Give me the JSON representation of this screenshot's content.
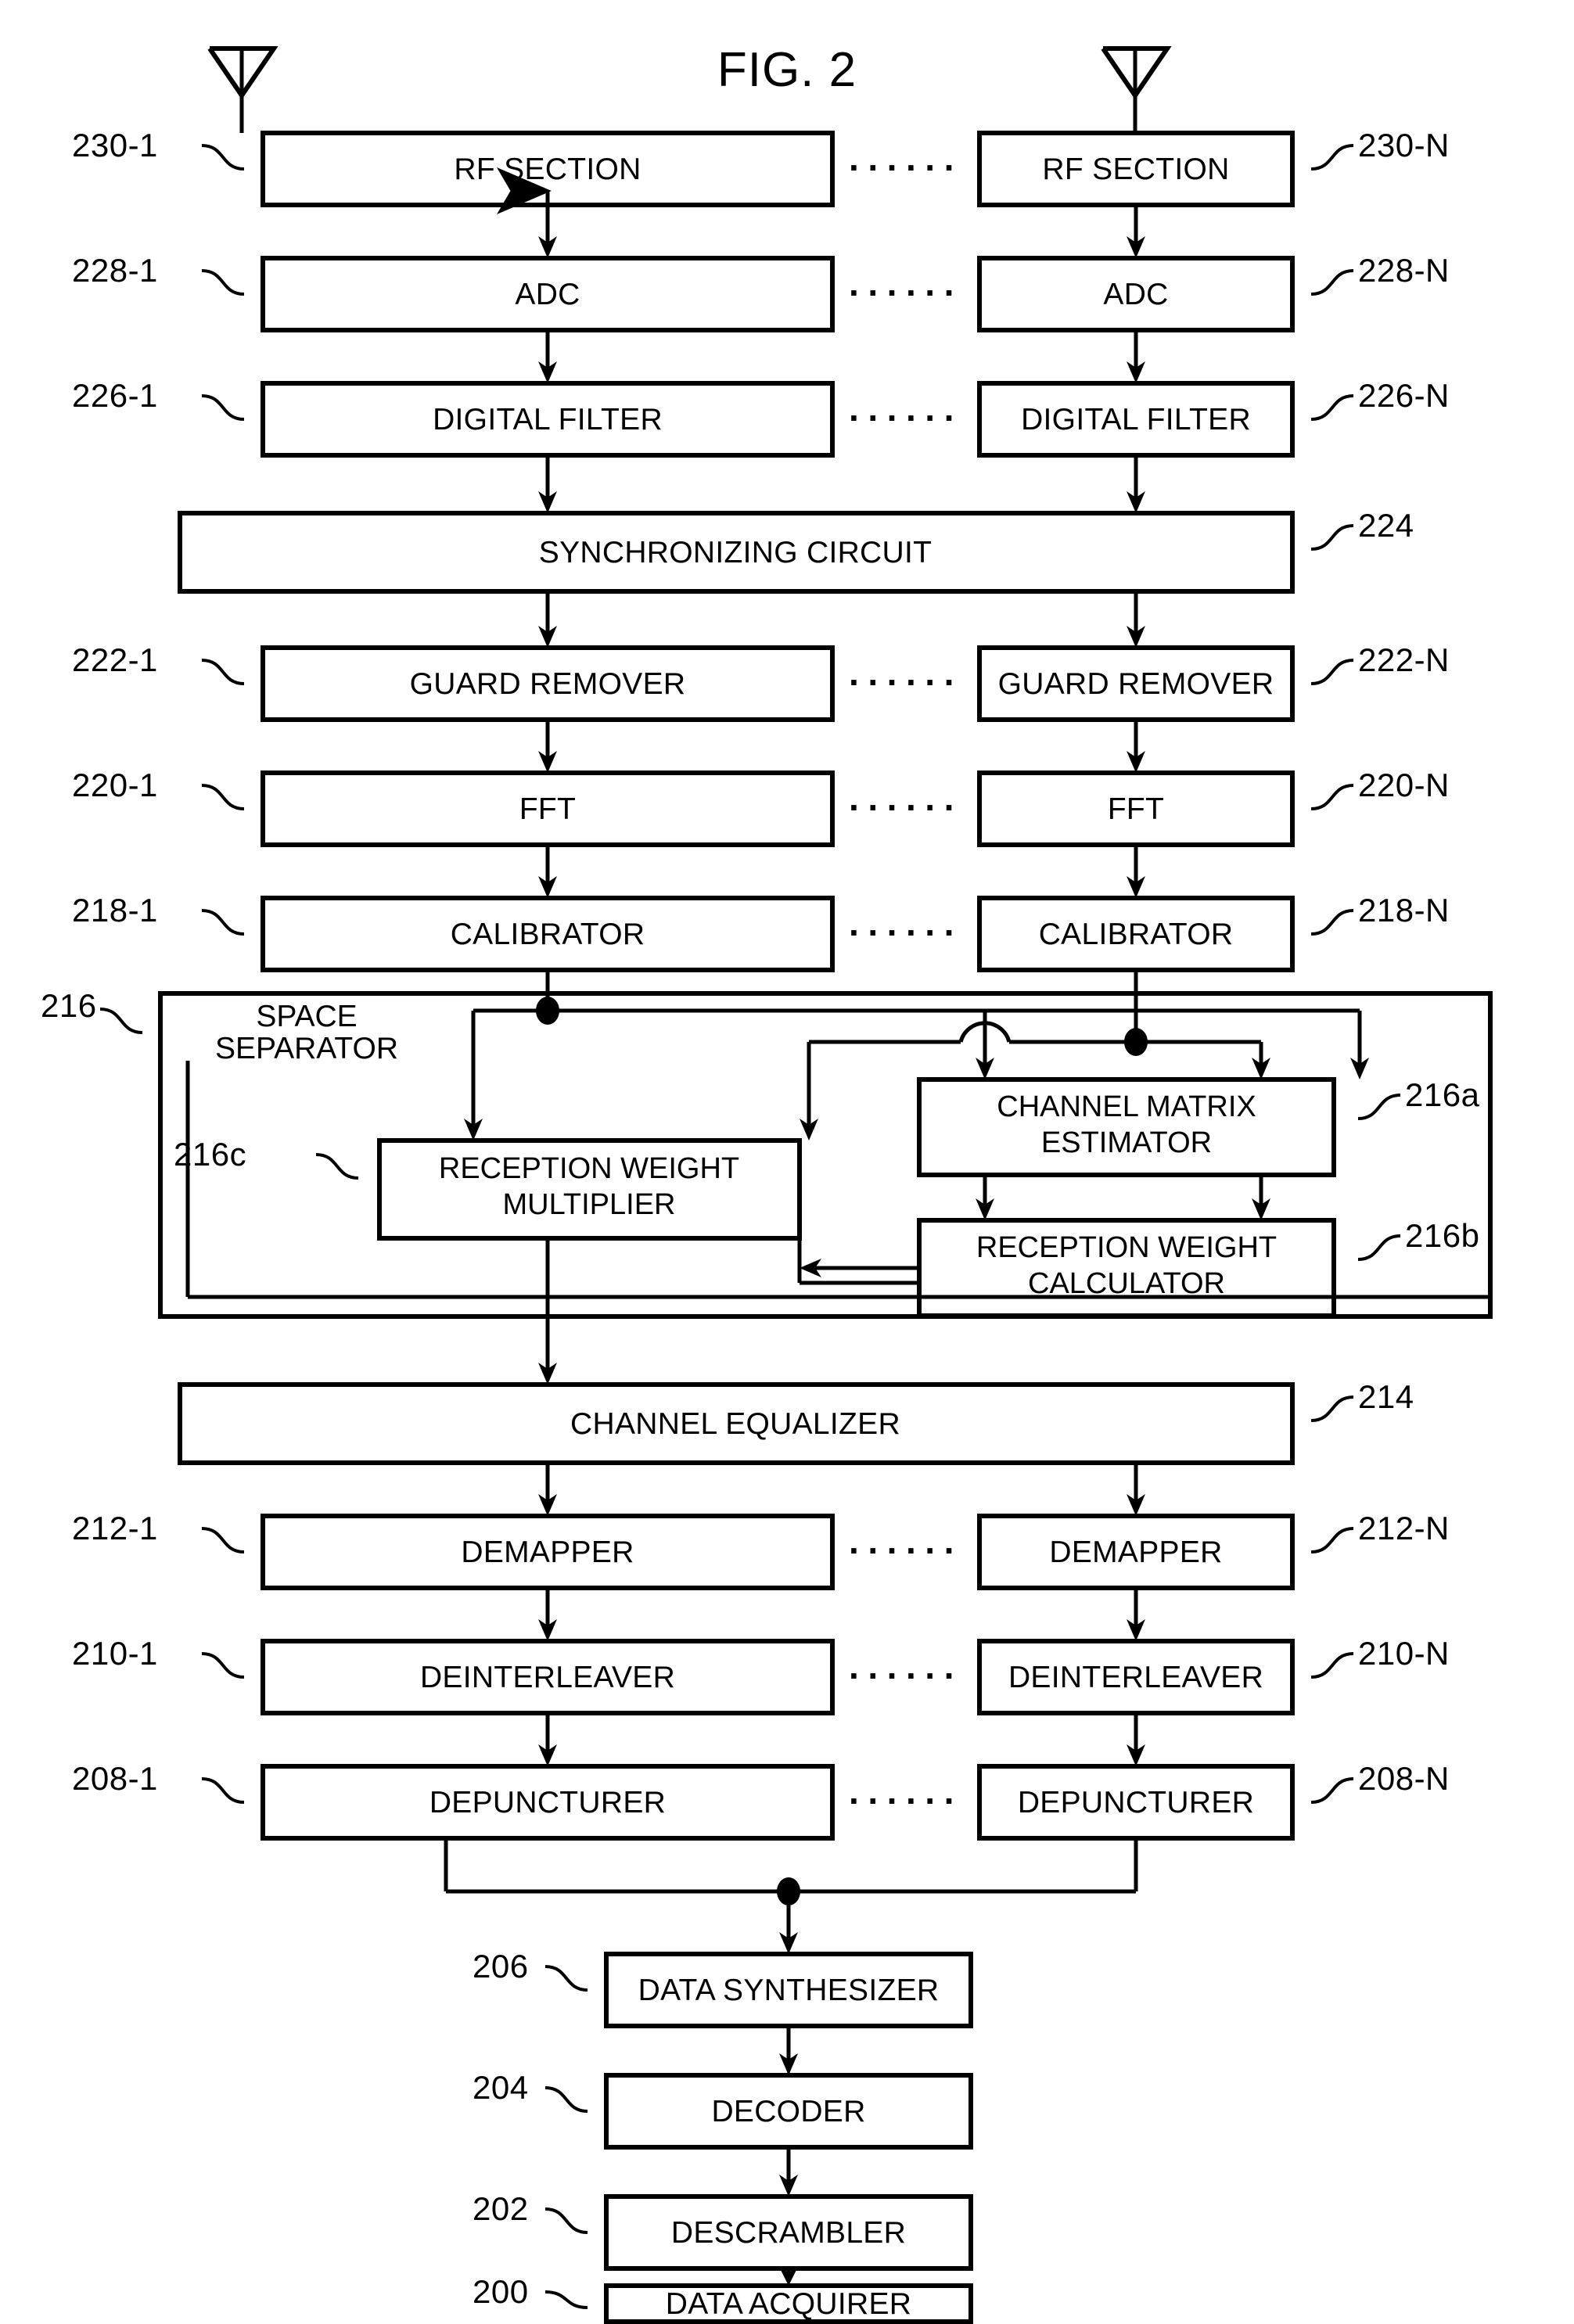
{
  "figure": {
    "title": "FIG. 2",
    "ellipsis": "······"
  },
  "blocks": {
    "rf_section": "RF SECTION",
    "adc": "ADC",
    "digital_filter": "DIGITAL FILTER",
    "synchronizing_circuit": "SYNCHRONIZING CIRCUIT",
    "guard_remover": "GUARD REMOVER",
    "fft": "FFT",
    "calibrator": "CALIBRATOR",
    "space_separator_line1": "SPACE",
    "space_separator_line2": "SEPARATOR",
    "channel_matrix_estimator_line1": "CHANNEL MATRIX",
    "channel_matrix_estimator_line2": "ESTIMATOR",
    "reception_weight_calculator_line1": "RECEPTION WEIGHT",
    "reception_weight_calculator_line2": "CALCULATOR",
    "reception_weight_multiplier_line1": "RECEPTION WEIGHT",
    "reception_weight_multiplier_line2": "MULTIPLIER",
    "channel_equalizer": "CHANNEL EQUALIZER",
    "demapper": "DEMAPPER",
    "deinterleaver": "DEINTERLEAVER",
    "depuncturer": "DEPUNCTURER",
    "data_synthesizer": "DATA SYNTHESIZER",
    "decoder": "DECODER",
    "descrambler": "DESCRAMBLER",
    "data_acquirer": "DATA ACQUIRER"
  },
  "reference_numerals": {
    "rf_section_1": "230-1",
    "rf_section_n": "230-N",
    "adc_1": "228-1",
    "adc_n": "228-N",
    "digital_filter_1": "226-1",
    "digital_filter_n": "226-N",
    "synchronizing_circuit": "224",
    "guard_remover_1": "222-1",
    "guard_remover_n": "222-N",
    "fft_1": "220-1",
    "fft_n": "220-N",
    "calibrator_1": "218-1",
    "calibrator_n": "218-N",
    "space_separator": "216",
    "channel_matrix_estimator": "216a",
    "reception_weight_calculator": "216b",
    "reception_weight_multiplier": "216c",
    "channel_equalizer": "214",
    "demapper_1": "212-1",
    "demapper_n": "212-N",
    "deinterleaver_1": "210-1",
    "deinterleaver_n": "210-N",
    "depuncturer_1": "208-1",
    "depuncturer_n": "208-N",
    "data_synthesizer": "206",
    "decoder": "204",
    "descrambler": "202",
    "data_acquirer": "200"
  },
  "chart_data": {
    "type": "diagram",
    "title": "FIG. 2",
    "description": "MIMO-OFDM receiver block diagram with N parallel receive chains",
    "nodes": [
      {
        "id": "230-1",
        "label": "RF SECTION",
        "chain": "1",
        "row": 1
      },
      {
        "id": "230-N",
        "label": "RF SECTION",
        "chain": "N",
        "row": 1
      },
      {
        "id": "228-1",
        "label": "ADC",
        "chain": "1",
        "row": 2
      },
      {
        "id": "228-N",
        "label": "ADC",
        "chain": "N",
        "row": 2
      },
      {
        "id": "226-1",
        "label": "DIGITAL FILTER",
        "chain": "1",
        "row": 3
      },
      {
        "id": "226-N",
        "label": "DIGITAL FILTER",
        "chain": "N",
        "row": 3
      },
      {
        "id": "224",
        "label": "SYNCHRONIZING CIRCUIT",
        "chain": "shared",
        "row": 4
      },
      {
        "id": "222-1",
        "label": "GUARD REMOVER",
        "chain": "1",
        "row": 5
      },
      {
        "id": "222-N",
        "label": "GUARD REMOVER",
        "chain": "N",
        "row": 5
      },
      {
        "id": "220-1",
        "label": "FFT",
        "chain": "1",
        "row": 6
      },
      {
        "id": "220-N",
        "label": "FFT",
        "chain": "N",
        "row": 6
      },
      {
        "id": "218-1",
        "label": "CALIBRATOR",
        "chain": "1",
        "row": 7
      },
      {
        "id": "218-N",
        "label": "CALIBRATOR",
        "chain": "N",
        "row": 7
      },
      {
        "id": "216",
        "label": "SPACE SEPARATOR",
        "chain": "shared",
        "row": 8
      },
      {
        "id": "216a",
        "label": "CHANNEL MATRIX ESTIMATOR",
        "chain": "shared",
        "row": 8
      },
      {
        "id": "216b",
        "label": "RECEPTION WEIGHT CALCULATOR",
        "chain": "shared",
        "row": 8
      },
      {
        "id": "216c",
        "label": "RECEPTION WEIGHT MULTIPLIER",
        "chain": "shared",
        "row": 8
      },
      {
        "id": "214",
        "label": "CHANNEL EQUALIZER",
        "chain": "shared",
        "row": 9
      },
      {
        "id": "212-1",
        "label": "DEMAPPER",
        "chain": "1",
        "row": 10
      },
      {
        "id": "212-N",
        "label": "DEMAPPER",
        "chain": "N",
        "row": 10
      },
      {
        "id": "210-1",
        "label": "DEINTERLEAVER",
        "chain": "1",
        "row": 11
      },
      {
        "id": "210-N",
        "label": "DEINTERLEAVER",
        "chain": "N",
        "row": 11
      },
      {
        "id": "208-1",
        "label": "DEPUNCTURER",
        "chain": "1",
        "row": 12
      },
      {
        "id": "208-N",
        "label": "DEPUNCTURER",
        "chain": "N",
        "row": 12
      },
      {
        "id": "206",
        "label": "DATA SYNTHESIZER",
        "chain": "shared",
        "row": 13
      },
      {
        "id": "204",
        "label": "DECODER",
        "chain": "shared",
        "row": 14
      },
      {
        "id": "202",
        "label": "DESCRAMBLER",
        "chain": "shared",
        "row": 15
      },
      {
        "id": "200",
        "label": "DATA ACQUIRER",
        "chain": "shared",
        "row": 16
      }
    ],
    "edges": [
      {
        "from": "antenna-1",
        "to": "230-1"
      },
      {
        "from": "antenna-N",
        "to": "230-N"
      },
      {
        "from": "230-1",
        "to": "228-1"
      },
      {
        "from": "230-N",
        "to": "228-N"
      },
      {
        "from": "228-1",
        "to": "226-1"
      },
      {
        "from": "228-N",
        "to": "226-N"
      },
      {
        "from": "226-1",
        "to": "224"
      },
      {
        "from": "226-N",
        "to": "224"
      },
      {
        "from": "224",
        "to": "222-1"
      },
      {
        "from": "224",
        "to": "222-N"
      },
      {
        "from": "222-1",
        "to": "220-1"
      },
      {
        "from": "222-N",
        "to": "220-N"
      },
      {
        "from": "220-1",
        "to": "218-1"
      },
      {
        "from": "220-N",
        "to": "218-N"
      },
      {
        "from": "218-1",
        "to": "216c"
      },
      {
        "from": "218-N",
        "to": "216c"
      },
      {
        "from": "218-1",
        "to": "216a"
      },
      {
        "from": "218-N",
        "to": "216a"
      },
      {
        "from": "216a",
        "to": "216b"
      },
      {
        "from": "216b",
        "to": "216c"
      },
      {
        "from": "216c",
        "to": "214"
      },
      {
        "from": "214",
        "to": "212-1"
      },
      {
        "from": "214",
        "to": "212-N"
      },
      {
        "from": "212-1",
        "to": "210-1"
      },
      {
        "from": "212-N",
        "to": "210-N"
      },
      {
        "from": "210-1",
        "to": "208-1"
      },
      {
        "from": "210-N",
        "to": "208-N"
      },
      {
        "from": "208-1",
        "to": "206"
      },
      {
        "from": "208-N",
        "to": "206"
      },
      {
        "from": "206",
        "to": "204"
      },
      {
        "from": "204",
        "to": "202"
      },
      {
        "from": "202",
        "to": "200"
      }
    ]
  }
}
